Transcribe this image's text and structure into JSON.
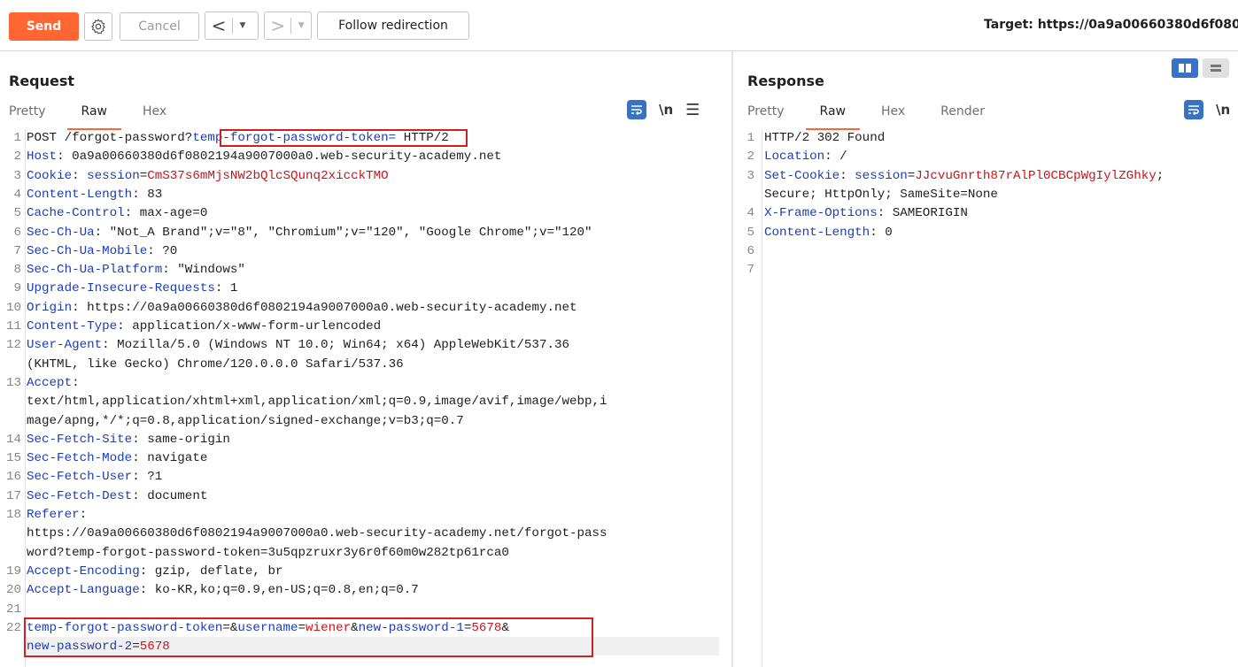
{
  "toolbar": {
    "send_label": "Send",
    "cancel_label": "Cancel",
    "back_glyph": "<",
    "forward_glyph": ">",
    "dropdown_glyph": "▼",
    "follow_label": "Follow redirection",
    "target_label": "Target: https://0a9a00660380d6f080"
  },
  "request": {
    "title": "Request",
    "tabs": [
      "Pretty",
      "Raw",
      "Hex"
    ],
    "active_tab": "Raw",
    "newline_label": "\\n",
    "line_numbers": [
      "1",
      "2",
      "3",
      "4",
      "5",
      "6",
      "7",
      "8",
      "9",
      "10",
      "11",
      "12",
      "",
      "13",
      "",
      "",
      "14",
      "15",
      "16",
      "17",
      "18",
      "",
      "",
      "19",
      "20",
      "21",
      "22",
      ""
    ],
    "lines": {
      "l1_pre": "POST /forgot-password?",
      "l1_param": "temp-forgot-password-token=",
      "l1_post": " HTTP/2",
      "l2_k": "Host",
      "l2_v": ": 0a9a00660380d6f0802194a9007000a0.web-security-academy.net",
      "l3_k": "Cookie",
      "l3_sep": ": ",
      "l3_ck": "session",
      "l3_eq": "=",
      "l3_cv": "CmS37s6mMjsNW2bQlcSQunq2xicckTMO",
      "l4_k": "Content-Length",
      "l4_v": ": 83",
      "l5_k": "Cache-Control",
      "l5_v": ": max-age=0",
      "l6_k": "Sec-Ch-Ua",
      "l6_v": ": \"Not_A Brand\";v=\"8\", \"Chromium\";v=\"120\", \"Google Chrome\";v=\"120\"",
      "l7_k": "Sec-Ch-Ua-Mobile",
      "l7_v": ": ?0",
      "l8_k": "Sec-Ch-Ua-Platform",
      "l8_v": ": \"Windows\"",
      "l9_k": "Upgrade-Insecure-Requests",
      "l9_v": ": 1",
      "l10_k": "Origin",
      "l10_v": ": https://0a9a00660380d6f0802194a9007000a0.web-security-academy.net",
      "l11_k": "Content-Type",
      "l11_v": ": application/x-www-form-urlencoded",
      "l12_k": "User-Agent",
      "l12_v": ": Mozilla/5.0 (Windows NT 10.0; Win64; x64) AppleWebKit/537.36",
      "l12b": "(KHTML, like Gecko) Chrome/120.0.0.0 Safari/537.36",
      "l13_k": "Accept",
      "l13_v": ":",
      "l13b": "text/html,application/xhtml+xml,application/xml;q=0.9,image/avif,image/webp,i",
      "l13c": "mage/apng,*/*;q=0.8,application/signed-exchange;v=b3;q=0.7",
      "l14_k": "Sec-Fetch-Site",
      "l14_v": ": same-origin",
      "l15_k": "Sec-Fetch-Mode",
      "l15_v": ": navigate",
      "l16_k": "Sec-Fetch-User",
      "l16_v": ": ?1",
      "l17_k": "Sec-Fetch-Dest",
      "l17_v": ": document",
      "l18_k": "Referer",
      "l18_v": ":",
      "l18b": "https://0a9a00660380d6f0802194a9007000a0.web-security-academy.net/forgot-pass",
      "l18c": "word?temp-forgot-password-token=3u5qpzruxr3y6r0f60m0w282tp61rca0",
      "l19_k": "Accept-Encoding",
      "l19_v": ": gzip, deflate, br",
      "l20_k": "Accept-Language",
      "l20_v": ": ko-KR,ko;q=0.9,en-US;q=0.8,en;q=0.7",
      "l22_p1": "temp-forgot-password-token",
      "l22_s1": "=&",
      "l22_p2": "username",
      "l22_s2": "=",
      "l22_v2": "wiener",
      "l22_s3": "&",
      "l22_p3": "new-password-1",
      "l22_s4": "=",
      "l22_v3": "5678",
      "l22_s5": "&",
      "l22b_p": "new-password-2",
      "l22b_s": "=",
      "l22b_v": "5678"
    }
  },
  "response": {
    "title": "Response",
    "tabs": [
      "Pretty",
      "Raw",
      "Hex",
      "Render"
    ],
    "active_tab": "Raw",
    "newline_label": "\\n",
    "line_numbers": [
      "1",
      "2",
      "3",
      "",
      "4",
      "5",
      "6",
      "7"
    ],
    "lines": {
      "r1": "HTTP/2 302 Found",
      "r2_k": "Location",
      "r2_v": ": /",
      "r3_k": "Set-Cookie",
      "r3_sep": ": ",
      "r3_ck": "session",
      "r3_eq": "=",
      "r3_cv": "JJcvuGnrth87rAlPl0CBCpWgIylZGhky",
      "r3_end": ";",
      "r3b": "Secure; HttpOnly; SameSite=None",
      "r4_k": "X-Frame-Options",
      "r4_v": ": SAMEORIGIN",
      "r5_k": "Content-Length",
      "r5_v": ": 0"
    }
  },
  "colors": {
    "accent": "#ff6633",
    "header_name": "#1b3eb5",
    "value_red": "#c8141a",
    "annotation_box": "#d21f1f",
    "toggle_blue": "#3872c7"
  }
}
